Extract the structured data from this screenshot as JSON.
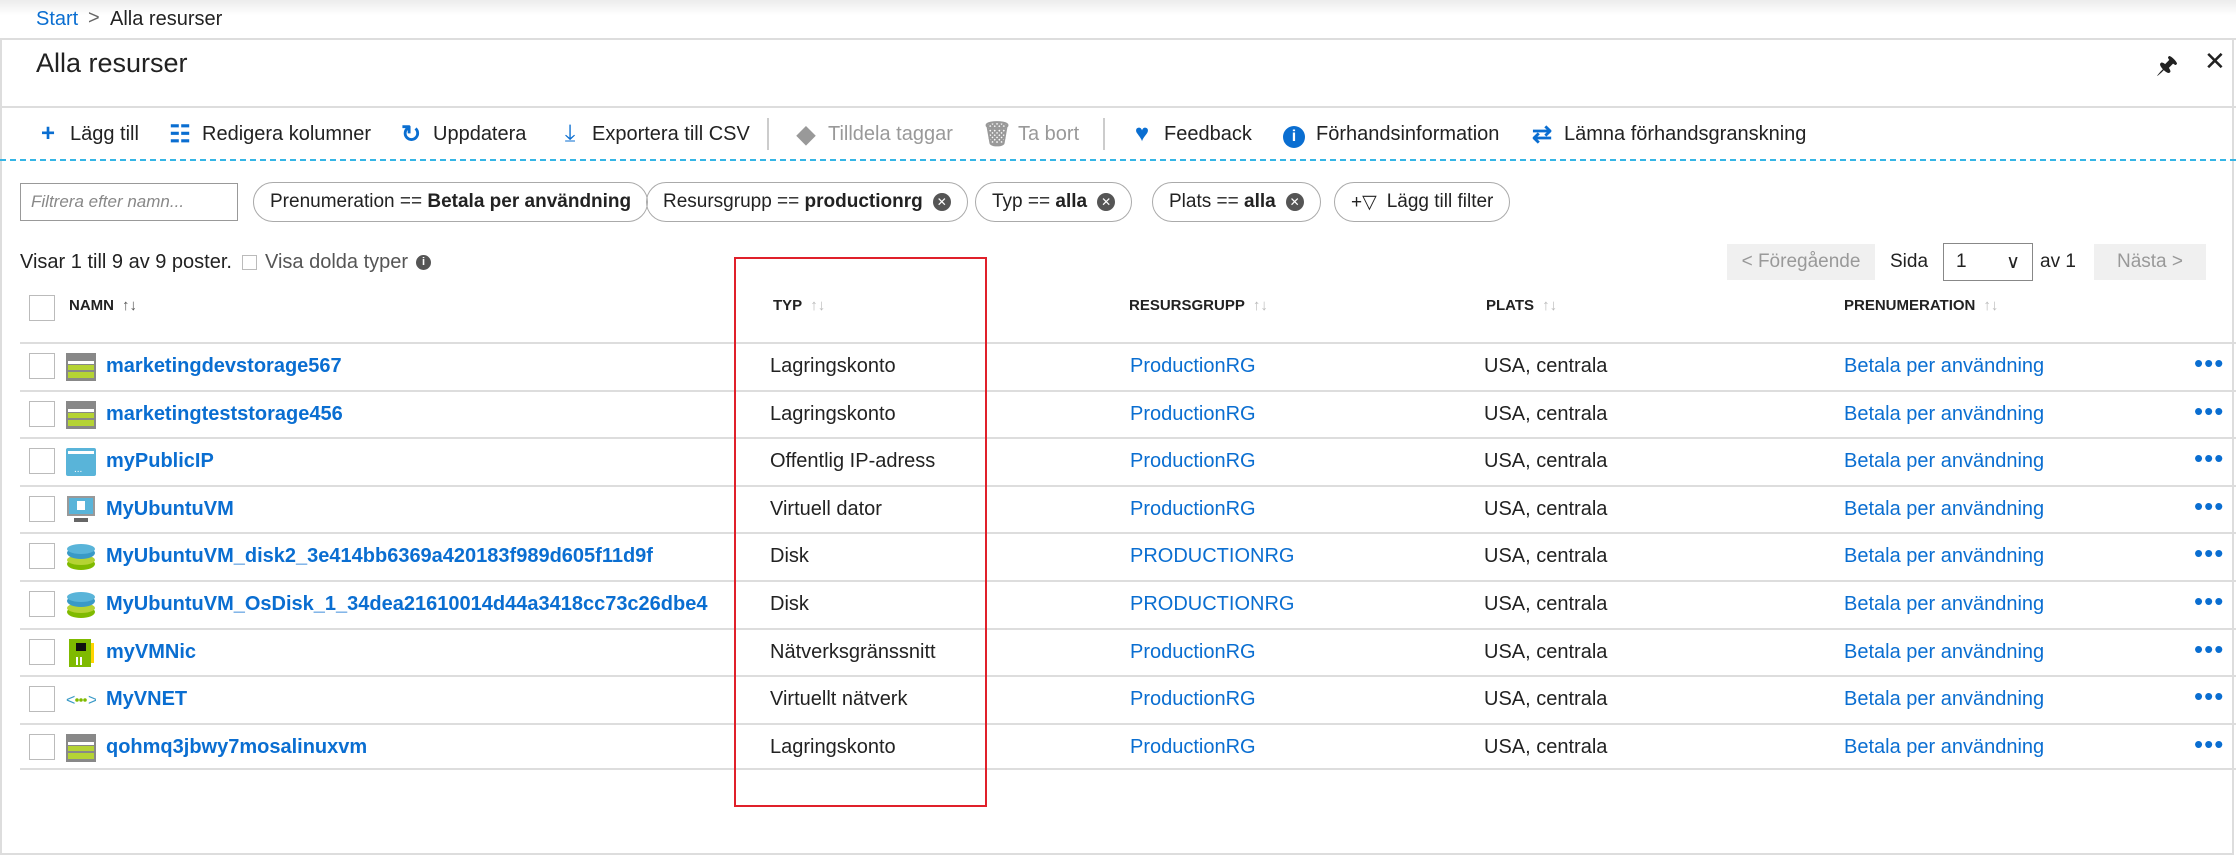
{
  "breadcrumb": {
    "start": "Start",
    "separator": ">",
    "current": "Alla resurser"
  },
  "title": "Alla resurser",
  "window_icons": {
    "pin": "pin-icon",
    "close": "close-icon"
  },
  "toolbar": {
    "add": "Lägg till",
    "edit_columns": "Redigera kolumner",
    "refresh": "Uppdatera",
    "export": "Exportera till CSV",
    "assign_tags": "Tilldela taggar",
    "delete": "Ta bort",
    "feedback": "Feedback",
    "preview_info": "Förhandsinformation",
    "leave_preview": "Lämna förhandsgranskning"
  },
  "filters": {
    "placeholder": "Filtrera efter namn...",
    "pills": [
      {
        "label": "Prenumeration ==",
        "value": "Betala per användning"
      },
      {
        "label": "Resursgrupp ==",
        "value": "productionrg"
      },
      {
        "label": "Typ ==",
        "value": "alla"
      },
      {
        "label": "Plats ==",
        "value": "alla"
      }
    ],
    "add_filter": "Lägg till filter"
  },
  "summary": {
    "count": "Visar 1 till 9 av 9 poster.",
    "show_hidden": "Visa dolda typer"
  },
  "pagination": {
    "prev": "< Föregående",
    "page_label": "Sida",
    "page": "1",
    "of": "av 1",
    "next": "Nästa >"
  },
  "columns": {
    "name": "NAMN",
    "type": "TYP",
    "group": "RESURSGRUPP",
    "location": "PLATS",
    "subscription": "PRENUMERATION"
  },
  "rows": [
    {
      "icon": "storage",
      "name": "marketingdevstorage567",
      "type": "Lagringskonto",
      "group": "ProductionRG",
      "location": "USA, centrala",
      "subscription": "Betala per användning"
    },
    {
      "icon": "storage",
      "name": "marketingteststorage456",
      "type": "Lagringskonto",
      "group": "ProductionRG",
      "location": "USA, centrala",
      "subscription": "Betala per användning"
    },
    {
      "icon": "public-ip",
      "name": "myPublicIP",
      "type": "Offentlig IP-adress",
      "group": "ProductionRG",
      "location": "USA, centrala",
      "subscription": "Betala per användning"
    },
    {
      "icon": "vm",
      "name": "MyUbuntuVM",
      "type": "Virtuell dator",
      "group": "ProductionRG",
      "location": "USA, centrala",
      "subscription": "Betala per användning"
    },
    {
      "icon": "disk",
      "name": "MyUbuntuVM_disk2_3e414bb6369a420183f989d605f11d9f",
      "type": "Disk",
      "group": "PRODUCTIONRG",
      "location": "USA, centrala",
      "subscription": "Betala per användning"
    },
    {
      "icon": "disk",
      "name": "MyUbuntuVM_OsDisk_1_34dea21610014d44a3418cc73c26dbe4",
      "type": "Disk",
      "group": "PRODUCTIONRG",
      "location": "USA, centrala",
      "subscription": "Betala per användning"
    },
    {
      "icon": "nic",
      "name": "myVMNic",
      "type": "Nätverksgränssnitt",
      "group": "ProductionRG",
      "location": "USA, centrala",
      "subscription": "Betala per användning"
    },
    {
      "icon": "vnet",
      "name": "MyVNET",
      "type": "Virtuellt nätverk",
      "group": "ProductionRG",
      "location": "USA, centrala",
      "subscription": "Betala per användning"
    },
    {
      "icon": "storage",
      "name": "qohmq3jbwy7mosalinuxvm",
      "type": "Lagringskonto",
      "group": "ProductionRG",
      "location": "USA, centrala",
      "subscription": "Betala per användning"
    }
  ],
  "colors": {
    "accent": "#0a6ed1",
    "highlight": "#e0202a"
  }
}
